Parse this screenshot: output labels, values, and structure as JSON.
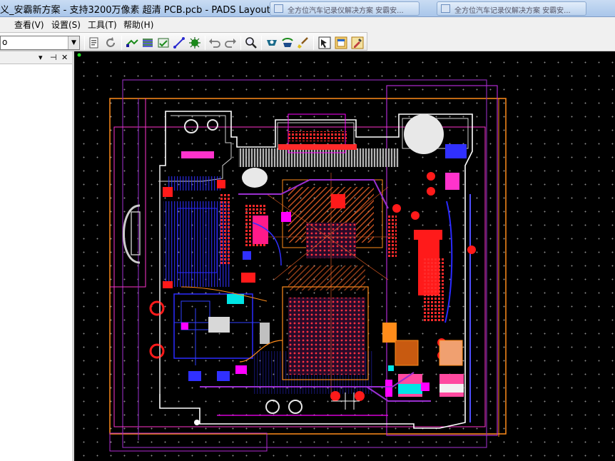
{
  "window": {
    "title": "义_安霸新方案 - 支持3200万像素 超清  PCB.pcb - PADS Layout"
  },
  "taskbar": {
    "buttons": [
      "全方位汽车记录仪解决方案 安霸安...",
      "全方位汽车记录仪解决方案 安霸安..."
    ]
  },
  "menu": {
    "items": [
      "查看(V)",
      "设置(S)",
      "工具(T)",
      "帮助(H)"
    ]
  },
  "toolbar": {
    "layer_combo_value": "o"
  },
  "project_panel": {
    "pin_glyph": "▾",
    "pushpin_glyph": "⊣",
    "close_glyph": "✕"
  },
  "pcb": {
    "colors": {
      "background": "#000000",
      "board_outline": "#ffffff",
      "copper_red": "#ff1a1a",
      "trace_blue": "#2a2aff",
      "magenta": "#ff00ff",
      "purple": "#9a2fd0",
      "orange": "#ff8c1a",
      "cyan": "#00e5e5"
    }
  }
}
